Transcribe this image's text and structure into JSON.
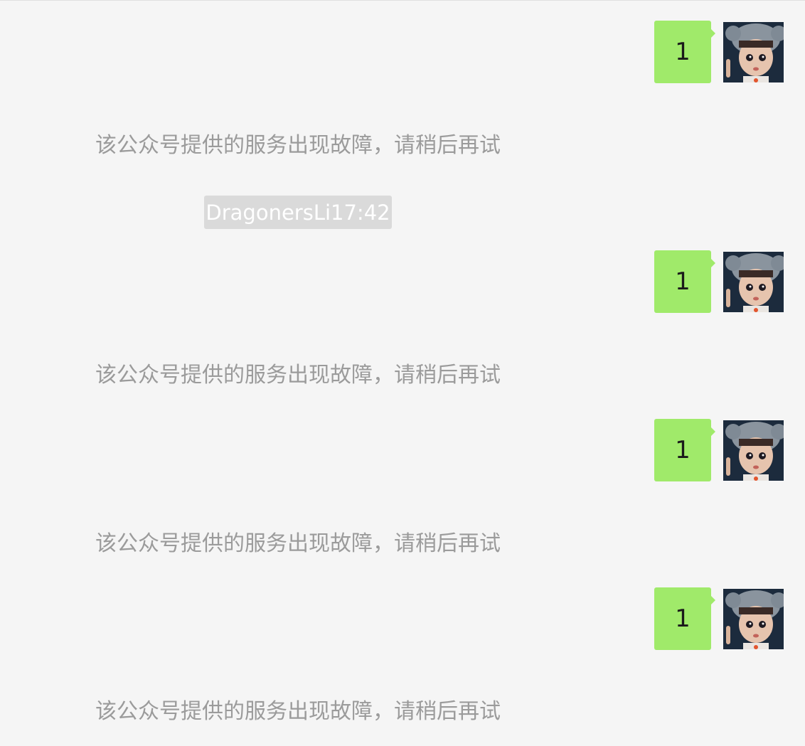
{
  "messages": [
    {
      "type": "sent",
      "text": "1"
    },
    {
      "type": "system",
      "text": "该公众号提供的服务出现故障，请稍后再试"
    },
    {
      "type": "time",
      "text": "DragonersLi17:42"
    },
    {
      "type": "sent",
      "text": "1"
    },
    {
      "type": "system",
      "text": "该公众号提供的服务出现故障，请稍后再试"
    },
    {
      "type": "sent",
      "text": "1"
    },
    {
      "type": "system",
      "text": "该公众号提供的服务出现故障，请稍后再试"
    },
    {
      "type": "sent",
      "text": "1"
    },
    {
      "type": "system",
      "text": "该公众号提供的服务出现故障，请稍后再试"
    }
  ],
  "avatar_icon": "doll-avatar-icon",
  "colors": {
    "background": "#f5f5f5",
    "sent_bubble": "#a0ea6a",
    "system_text": "#9b9b9b",
    "time_chip": "#dadada"
  }
}
